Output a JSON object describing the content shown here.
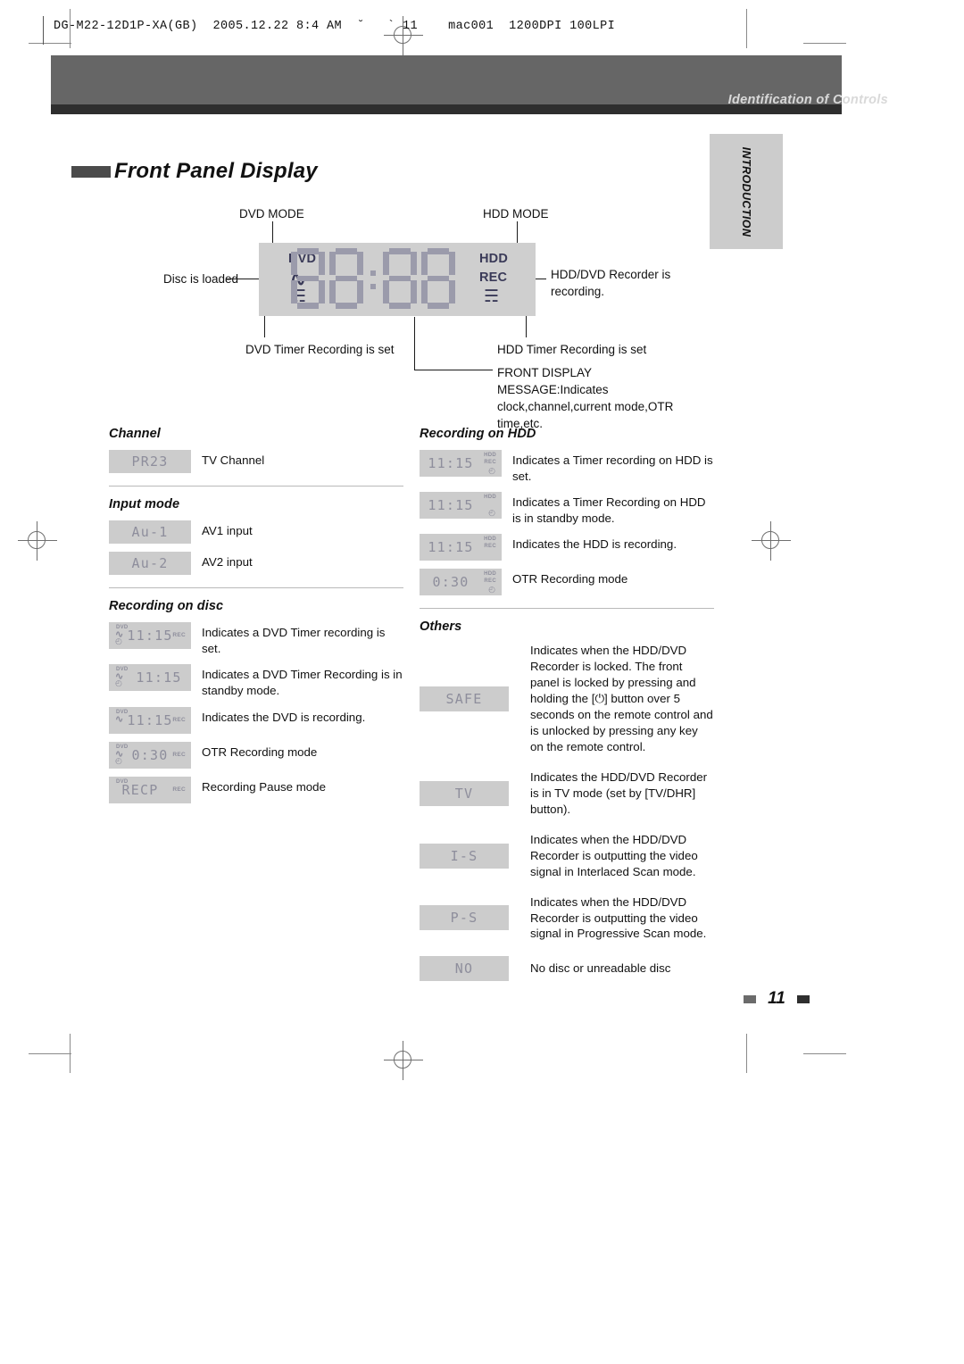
{
  "slug": "DG-M22-12D1P-XA(GB)  2005.12.22 8:4 AM  ˘   ` 11    mac001  1200DPI 100LPI",
  "header": {
    "chapter_title": "Identification of Controls",
    "side_tab": "INTRODUCTION"
  },
  "section": {
    "title": "Front Panel Display"
  },
  "diagram": {
    "dvd_mode": "DVD MODE",
    "hdd_mode": "HDD MODE",
    "disc_loaded": "Disc is loaded",
    "recorder_recording": "HDD/DVD Recorder is recording.",
    "dvd_timer_set": "DVD Timer Recording is set",
    "hdd_timer_set": "HDD Timer Recording is set",
    "front_display_message": "FRONT DISPLAY MESSAGE:Indicates clock,channel,current mode,OTR time,etc.",
    "panel": {
      "dvd_label": "DVD",
      "hdd_label": "HDD",
      "rec_label": "REC",
      "digits": "88:88"
    }
  },
  "channel": {
    "heading": "Channel",
    "rows": [
      {
        "lcd": "PR23",
        "desc": "TV Channel"
      }
    ]
  },
  "input_mode": {
    "heading": "Input mode",
    "rows": [
      {
        "lcd": "Au-1",
        "desc": "AV1 input"
      },
      {
        "lcd": "Au-2",
        "desc": "AV2 input"
      }
    ]
  },
  "recording_on_disc": {
    "heading": "Recording on disc",
    "rows": [
      {
        "lcd": "11:15",
        "dvd": "DVD",
        "disc": "∿",
        "clock": "◴",
        "rec": "REC",
        "desc": "Indicates a DVD Timer recording is set."
      },
      {
        "lcd": "11:15",
        "dvd": "DVD",
        "disc": "∿",
        "clock": "◴",
        "rec": "",
        "desc": "Indicates a DVD Timer Recording is in standby mode."
      },
      {
        "lcd": "11:15",
        "dvd": "DVD",
        "disc": "∿",
        "clock": "",
        "rec": "REC",
        "desc": "Indicates the DVD is recording."
      },
      {
        "lcd": "0:30",
        "dvd": "DVD",
        "disc": "∿",
        "clock": "◴",
        "rec": "REC",
        "desc": "OTR Recording mode"
      },
      {
        "lcd": "RECP",
        "dvd": "DVD",
        "disc": "",
        "clock": "",
        "rec": "REC",
        "desc": "Recording Pause mode"
      }
    ]
  },
  "recording_on_hdd": {
    "heading": "Recording on HDD",
    "rows": [
      {
        "lcd": "11:15",
        "hdd": "HDD",
        "rec": "REC",
        "clock": "◴",
        "desc": "Indicates a Timer recording on HDD is set."
      },
      {
        "lcd": "11:15",
        "hdd": "HDD",
        "rec": "",
        "clock": "◴",
        "desc": "Indicates a Timer Recording on HDD is in standby mode."
      },
      {
        "lcd": "11:15",
        "hdd": "HDD",
        "rec": "REC",
        "clock": "",
        "desc": "Indicates the HDD is recording."
      },
      {
        "lcd": "0:30",
        "hdd": "HDD",
        "rec": "REC",
        "clock": "◴",
        "desc": "OTR Recording mode"
      }
    ]
  },
  "others": {
    "heading": "Others",
    "rows": [
      {
        "lcd": "SAFE",
        "desc": "Indicates when the HDD/DVD Recorder is locked. The front panel is locked by pressing and holding the [⏻] button over 5 seconds on the remote control and is unlocked by pressing any key on the remote control."
      },
      {
        "lcd": "TV",
        "desc": "Indicates the HDD/DVD Recorder is in TV mode (set by [TV/DHR] button)."
      },
      {
        "lcd": "I-S",
        "desc": "Indicates when the HDD/DVD Recorder is outputting the video signal in Interlaced Scan mode."
      },
      {
        "lcd": "P-S",
        "desc": "Indicates when the HDD/DVD Recorder is outputting the video signal in Progressive Scan mode."
      },
      {
        "lcd": "NO",
        "desc": "No disc or unreadable disc"
      }
    ]
  },
  "footer": {
    "page_number": "11"
  }
}
